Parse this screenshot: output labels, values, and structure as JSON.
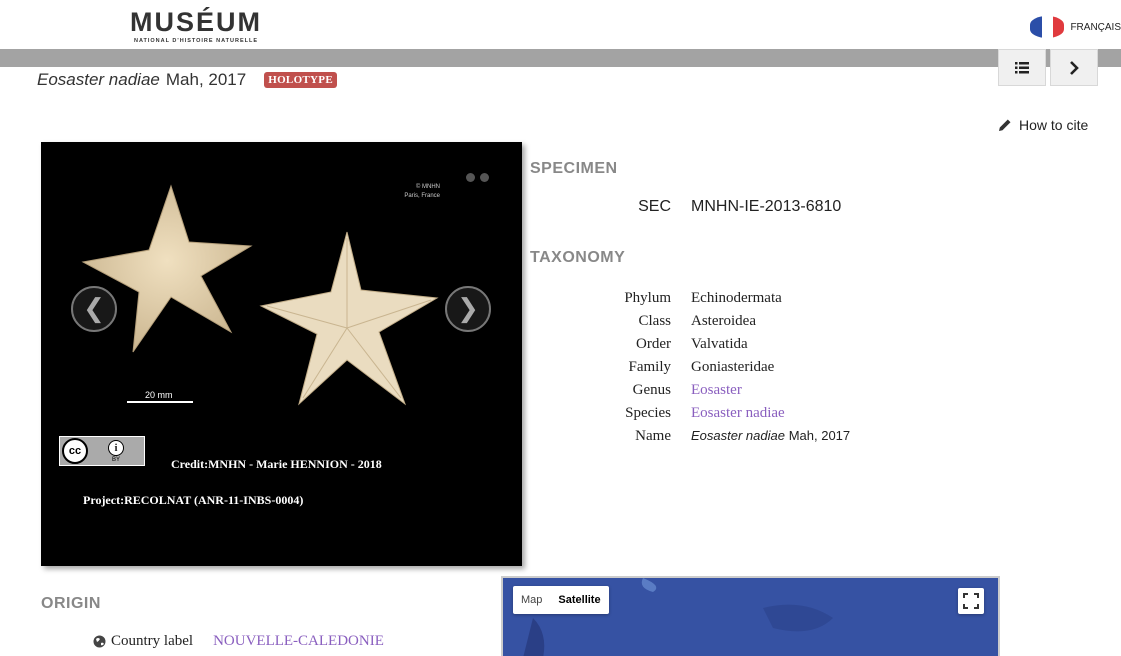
{
  "header": {
    "logo_main": "MUSÉUM",
    "logo_sub": "NATIONAL D'HISTOIRE NATURELLE",
    "language_label": "FRANÇAIS",
    "colors": {
      "flag_blue": "#2b4ea8",
      "flag_white": "#ffffff",
      "flag_red": "#e03a3e"
    }
  },
  "title": {
    "taxon_italic": "Eosaster nadiae",
    "author": "Mah, 2017",
    "badge": "HOLOTYPE",
    "badge_color": "#c0504d"
  },
  "toolbar": {
    "list_icon": "list-icon",
    "next_icon": "chevron-right-icon",
    "cite_label": "How to cite",
    "cite_icon": "pencil-icon"
  },
  "viewer": {
    "photo_mark_line1": "© MNHN",
    "photo_mark_line2": "Paris, France",
    "prev_glyph": "❮",
    "next_glyph": "❯",
    "scale_label": "20 mm",
    "cc_label": "cc",
    "cc_by_glyph": "i",
    "cc_by_label": "BY",
    "credit": "Credit:MNHN - Marie HENNION - 2018",
    "project": "Project:RECOLNAT (ANR-11-INBS-0004)"
  },
  "specimen": {
    "title": "SPECIMEN",
    "key": "SEC",
    "value": "MNHN-IE-2013-6810"
  },
  "taxonomy": {
    "title": "TAXONOMY",
    "rows": [
      {
        "key": "Phylum",
        "value": "Echinodermata"
      },
      {
        "key": "Class",
        "value": "Asteroidea"
      },
      {
        "key": "Order",
        "value": "Valvatida"
      },
      {
        "key": "Family",
        "value": "Goniasteridae"
      },
      {
        "key": "Genus",
        "value": "Eosaster"
      },
      {
        "key": "Species",
        "value": "Eosaster nadiae"
      },
      {
        "key": "Name",
        "value_italic": "Eosaster nadiae",
        "value_author": "Mah, 2017"
      }
    ],
    "link_color": "#8a5fbf"
  },
  "origin": {
    "title": "ORIGIN",
    "country_key": "Country label",
    "country_value": "NOUVELLE-CALEDONIE"
  },
  "map": {
    "map_label": "Map",
    "satellite_label": "Satellite",
    "fullscreen_icon": "fullscreen-icon"
  }
}
